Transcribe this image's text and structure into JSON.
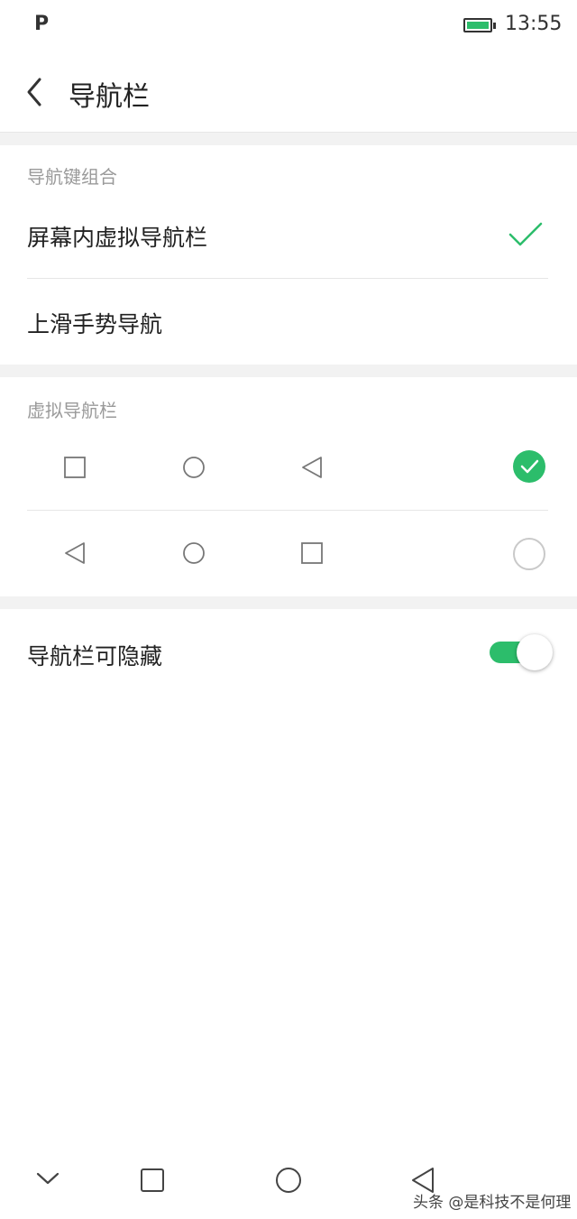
{
  "status_bar": {
    "app_icon": "P",
    "time": "13:55",
    "battery_icon": "battery-charging-icon"
  },
  "header": {
    "title": "导航栏",
    "back_icon": "chevron-left-icon"
  },
  "nav_key_section": {
    "heading": "导航键组合",
    "options": [
      {
        "label": "屏幕内虚拟导航栏",
        "selected": true
      },
      {
        "label": "上滑手势导航",
        "selected": false
      }
    ]
  },
  "virtual_bar_section": {
    "heading": "虚拟导航栏",
    "layouts": [
      {
        "icons": [
          "square-icon",
          "circle-icon",
          "triangle-left-icon"
        ],
        "selected": true
      },
      {
        "icons": [
          "triangle-left-icon",
          "circle-icon",
          "square-icon"
        ],
        "selected": false
      }
    ]
  },
  "hide_setting": {
    "label": "导航栏可隐藏",
    "enabled": true
  },
  "system_nav": {
    "icons": [
      "chevron-down-icon",
      "square-icon",
      "circle-icon",
      "triangle-left-icon"
    ]
  },
  "watermark": "头条 @是科技不是何理",
  "colors": {
    "accent": "#2cbd6b",
    "section_gap": "#f2f2f2",
    "secondary_text": "#9a9a9a"
  }
}
